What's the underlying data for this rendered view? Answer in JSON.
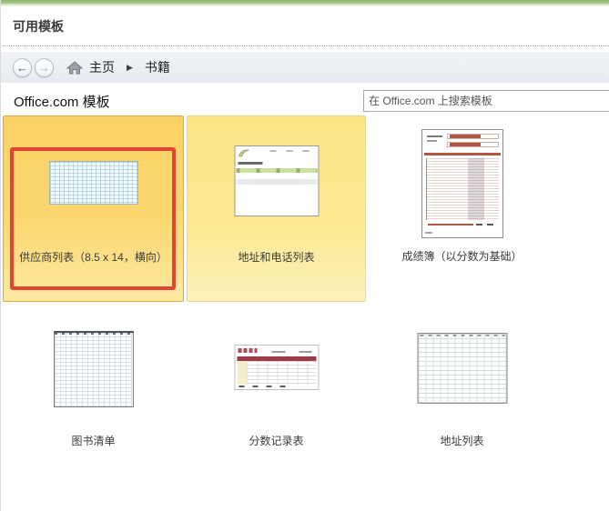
{
  "page": {
    "title": "可用模板"
  },
  "nav": {
    "back_icon": "←",
    "forward_icon": "→",
    "home_label": "主页",
    "crumb_sep": "▶",
    "current_label": "书籍"
  },
  "section": {
    "title": "Office.com 模板",
    "search_placeholder": "在 Office.com 上搜索模板"
  },
  "templates": [
    {
      "label": "供应商列表（8.5 x 14，横向）",
      "state": "selected",
      "annotated": true
    },
    {
      "label": "地址和电话列表",
      "state": "highlighted"
    },
    {
      "label": "成绩簿（以分数为基础）",
      "state": "normal"
    },
    {
      "label": "图书清单",
      "state": "normal"
    },
    {
      "label": "分数记录表",
      "state": "normal"
    },
    {
      "label": "地址列表",
      "state": "normal"
    }
  ],
  "colors": {
    "top_strip_green": "#8fb56c",
    "selected_tile_gold": "#fbd165",
    "highlighted_tile_yellow": "#fce386",
    "annotation_red": "#e44431",
    "gradebook_accent": "#b25741",
    "score_header_red": "#9e3b49"
  }
}
